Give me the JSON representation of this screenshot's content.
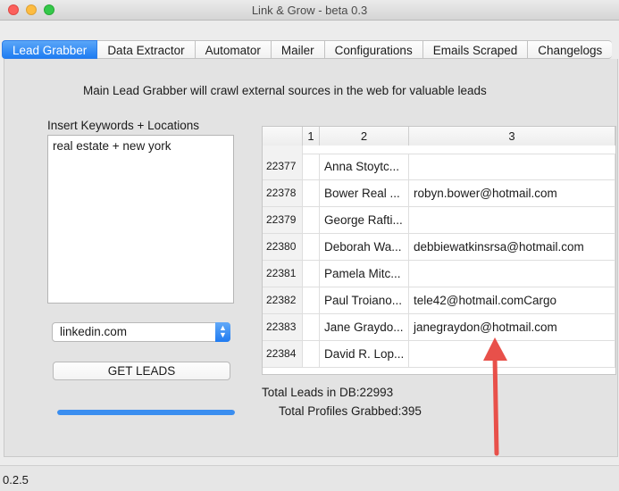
{
  "window": {
    "title": "Link & Grow - beta 0.3"
  },
  "tabs": [
    {
      "label": "Lead Grabber",
      "active": true
    },
    {
      "label": "Data Extractor"
    },
    {
      "label": "Automator"
    },
    {
      "label": "Mailer"
    },
    {
      "label": "Configurations"
    },
    {
      "label": "Emails Scraped"
    },
    {
      "label": "Changelogs"
    }
  ],
  "intro": "Main Lead Grabber will crawl external sources in the web for valuable leads",
  "keywords": {
    "label": "Insert Keywords + Locations",
    "value": "real estate + new york"
  },
  "source_select": {
    "value": "linkedin.com"
  },
  "get_leads_button": "GET LEADS",
  "progress": {
    "fraction": 1.0,
    "color": "#3a8ef0"
  },
  "table": {
    "headers": [
      "",
      "1",
      "2",
      "3"
    ],
    "rows": [
      {
        "id": "22377",
        "c1": "",
        "c2": "Anna Stoytc...",
        "c3": ""
      },
      {
        "id": "22378",
        "c1": "",
        "c2": "Bower Real ...",
        "c3": "robyn.bower@hotmail.com"
      },
      {
        "id": "22379",
        "c1": "",
        "c2": "George Rafti...",
        "c3": ""
      },
      {
        "id": "22380",
        "c1": "",
        "c2": "Deborah Wa...",
        "c3": "debbiewatkinsrsa@hotmail.com"
      },
      {
        "id": "22381",
        "c1": "",
        "c2": "Pamela Mitc...",
        "c3": ""
      },
      {
        "id": "22382",
        "c1": "",
        "c2": "Paul Troiano...",
        "c3": "tele42@hotmail.comCargo"
      },
      {
        "id": "22383",
        "c1": "",
        "c2": "Jane Graydo...",
        "c3": "janegraydon@hotmail.com"
      },
      {
        "id": "22384",
        "c1": "",
        "c2": "David R. Lop...",
        "c3": ""
      }
    ]
  },
  "totals": {
    "leads_in_db": "Total Leads in DB:22993",
    "profiles_grabbed": "Total Profiles Grabbed:395"
  },
  "status": {
    "version": "0.2.5"
  },
  "colors": {
    "accent": "#1e7cf2",
    "annotation_arrow": "#e8504a"
  }
}
